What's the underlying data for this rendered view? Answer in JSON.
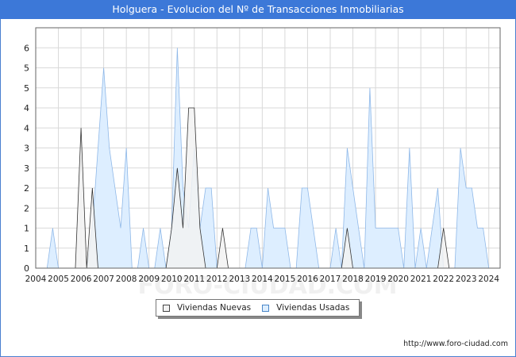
{
  "title": "Holguera - Evolucion del Nº de Transacciones Inmobiliarias",
  "legend": {
    "nuevas_label": "Viviendas Nuevas",
    "usadas_label": "Viviendas Usadas"
  },
  "source_url": "http://www.foro-ciudad.com",
  "watermark": "FORO-CIUDAD.COM",
  "colors": {
    "header": "#3c78d8",
    "nuevas_fill": "#f2f2f2",
    "nuevas_line": "#333333",
    "usadas_fill": "#ddeeff",
    "usadas_line": "#8fb8e8",
    "grid": "#d9d9d9"
  },
  "chart_data": {
    "type": "area",
    "x_unit": "year",
    "xlim": [
      2004,
      2024.5
    ],
    "ylim": [
      0,
      6
    ],
    "y_ticks": [
      0,
      1,
      1,
      2,
      2,
      3,
      3,
      4,
      4,
      5,
      5,
      6
    ],
    "x_ticks": [
      "2004",
      "2005",
      "2006",
      "2007",
      "2008",
      "2009",
      "2010",
      "2011",
      "2012",
      "2013",
      "2014",
      "2015",
      "2016",
      "2017",
      "2018",
      "2019",
      "2020",
      "2021",
      "2022",
      "2023",
      "2024"
    ],
    "grid": true,
    "legend_position": "bottom-center",
    "series": [
      {
        "name": "Viviendas Usadas",
        "points": [
          [
            2004.5,
            0
          ],
          [
            2004.75,
            1
          ],
          [
            2005.0,
            0
          ],
          [
            2006.25,
            0
          ],
          [
            2006.5,
            1
          ],
          [
            2006.75,
            3
          ],
          [
            2007.0,
            5
          ],
          [
            2007.25,
            3
          ],
          [
            2007.5,
            2
          ],
          [
            2007.75,
            1
          ],
          [
            2008.0,
            3
          ],
          [
            2008.25,
            0
          ],
          [
            2008.5,
            0
          ],
          [
            2008.75,
            1
          ],
          [
            2009.0,
            0
          ],
          [
            2009.25,
            0
          ],
          [
            2009.5,
            1
          ],
          [
            2009.75,
            0
          ],
          [
            2010.0,
            1
          ],
          [
            2010.25,
            5.5
          ],
          [
            2010.5,
            2
          ],
          [
            2010.75,
            1
          ],
          [
            2011.0,
            3
          ],
          [
            2011.25,
            1
          ],
          [
            2011.5,
            2
          ],
          [
            2011.75,
            2
          ],
          [
            2012.0,
            0
          ],
          [
            2013.25,
            0
          ],
          [
            2013.5,
            1
          ],
          [
            2013.75,
            1
          ],
          [
            2014.0,
            0
          ],
          [
            2014.25,
            2
          ],
          [
            2014.5,
            1
          ],
          [
            2014.75,
            1
          ],
          [
            2015.0,
            1
          ],
          [
            2015.25,
            0
          ],
          [
            2015.5,
            0
          ],
          [
            2015.75,
            2
          ],
          [
            2016.0,
            2
          ],
          [
            2016.25,
            1
          ],
          [
            2016.5,
            0
          ],
          [
            2017.0,
            0
          ],
          [
            2017.25,
            1
          ],
          [
            2017.5,
            0
          ],
          [
            2017.75,
            3
          ],
          [
            2018.0,
            2
          ],
          [
            2018.25,
            1
          ],
          [
            2018.5,
            0
          ],
          [
            2018.75,
            4.5
          ],
          [
            2019.0,
            1
          ],
          [
            2019.25,
            1
          ],
          [
            2019.5,
            1
          ],
          [
            2019.75,
            1
          ],
          [
            2020.0,
            1
          ],
          [
            2020.25,
            0
          ],
          [
            2020.5,
            3
          ],
          [
            2020.75,
            0
          ],
          [
            2021.0,
            1
          ],
          [
            2021.25,
            0
          ],
          [
            2021.5,
            1
          ],
          [
            2021.75,
            2
          ],
          [
            2022.0,
            0
          ],
          [
            2022.5,
            0
          ],
          [
            2022.75,
            3
          ],
          [
            2023.0,
            2
          ],
          [
            2023.25,
            2
          ],
          [
            2023.5,
            1
          ],
          [
            2023.75,
            1
          ],
          [
            2024.0,
            0
          ]
        ]
      },
      {
        "name": "Viviendas Nuevas",
        "points": [
          [
            2005.75,
            0
          ],
          [
            2006.0,
            3.5
          ],
          [
            2006.25,
            0
          ],
          [
            2006.5,
            2
          ],
          [
            2006.75,
            0
          ],
          [
            2009.75,
            0
          ],
          [
            2010.0,
            1
          ],
          [
            2010.25,
            2.5
          ],
          [
            2010.5,
            1
          ],
          [
            2010.75,
            4
          ],
          [
            2011.0,
            4
          ],
          [
            2011.25,
            1
          ],
          [
            2011.5,
            0
          ],
          [
            2012.0,
            0
          ],
          [
            2012.25,
            1
          ],
          [
            2012.5,
            0
          ],
          [
            2017.5,
            0
          ],
          [
            2017.75,
            1
          ],
          [
            2018.0,
            0
          ],
          [
            2021.75,
            0
          ],
          [
            2022.0,
            1
          ],
          [
            2022.25,
            0
          ]
        ]
      }
    ]
  }
}
